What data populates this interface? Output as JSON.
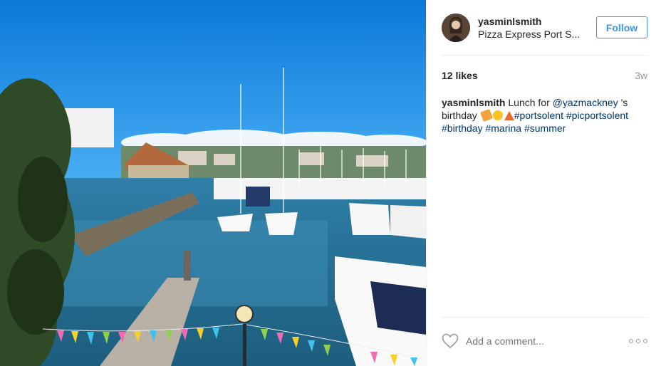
{
  "post": {
    "username": "yasminlsmith",
    "location": "Pizza Express Port S...",
    "follow_label": "Follow",
    "likes": "12 likes",
    "time_ago": "3w",
    "caption": {
      "username": "yasminlsmith",
      "text_before": "Lunch for",
      "mention": "@yazmackney",
      "text_after": "'s birthday",
      "hashtags": [
        "#portsolent",
        "#picportsolent",
        "#birthday",
        "#marina",
        "#summer"
      ]
    },
    "comment_placeholder": "Add a comment...",
    "icons": {
      "like": "heart-outline-icon",
      "more": "more-options-icon"
    },
    "colors": {
      "follow_blue": "#3897f0",
      "link_blue": "#003569",
      "muted": "#999999"
    }
  }
}
